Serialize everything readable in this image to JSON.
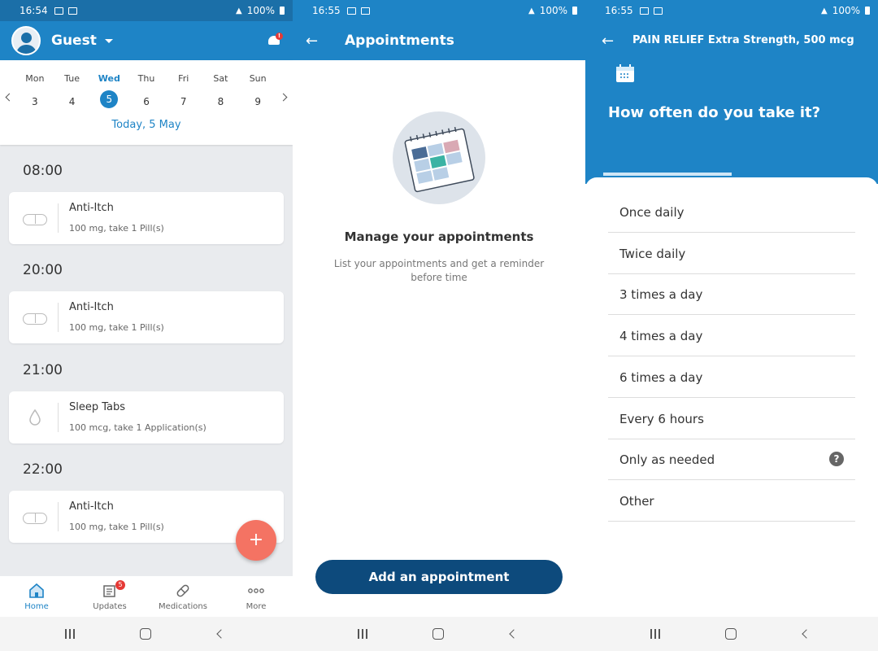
{
  "status": {
    "panel1_time": "16:54",
    "panel2_time": "16:55",
    "panel3_time": "16:55",
    "battery": "100%"
  },
  "home": {
    "user_name": "Guest",
    "notification_badge": "!",
    "days": [
      {
        "name": "Mon",
        "date": "3"
      },
      {
        "name": "Tue",
        "date": "4"
      },
      {
        "name": "Wed",
        "date": "5"
      },
      {
        "name": "Thu",
        "date": "6"
      },
      {
        "name": "Fri",
        "date": "7"
      },
      {
        "name": "Sat",
        "date": "8"
      },
      {
        "name": "Sun",
        "date": "9"
      }
    ],
    "selected_day_index": 2,
    "today_label": "Today, 5 May",
    "slots": [
      {
        "time": "08:00",
        "name": "Anti-Itch",
        "dose": "100 mg, take 1 Pill(s)",
        "icon": "pill-icon"
      },
      {
        "time": "20:00",
        "name": "Anti-Itch",
        "dose": "100 mg, take 1 Pill(s)",
        "icon": "pill-icon"
      },
      {
        "time": "21:00",
        "name": "Sleep Tabs",
        "dose": "100 mcg, take 1 Application(s)",
        "icon": "drop-icon"
      },
      {
        "time": "22:00",
        "name": "Anti-Itch",
        "dose": "100 mg, take 1 Pill(s)",
        "icon": "pill-icon"
      }
    ],
    "fab_label": "+",
    "nav": [
      {
        "label": "Home",
        "icon": "home-icon",
        "active": true
      },
      {
        "label": "Updates",
        "icon": "updates-icon",
        "badge": "5"
      },
      {
        "label": "Medications",
        "icon": "pill-nav-icon"
      },
      {
        "label": "More",
        "icon": "more-icon"
      }
    ]
  },
  "appointments": {
    "title": "Appointments",
    "heading": "Manage your appointments",
    "subtitle": "List your appointments and get a reminder before time",
    "button_label": "Add an appointment"
  },
  "frequency": {
    "title": "PAIN RELIEF Extra Strength, 500 mcg",
    "question": "How often do you take it?",
    "progress_fraction": 0.44,
    "options": [
      "Once daily",
      "Twice daily",
      "3 times a day",
      "4 times a day",
      "6 times a day",
      "Every 6 hours",
      "Only as needed",
      "Other"
    ],
    "help_label": "?"
  },
  "colors": {
    "primary": "#1e84c6",
    "primary_dark": "#0d4a7c",
    "fab": "#f47363",
    "badge": "#e53935"
  }
}
